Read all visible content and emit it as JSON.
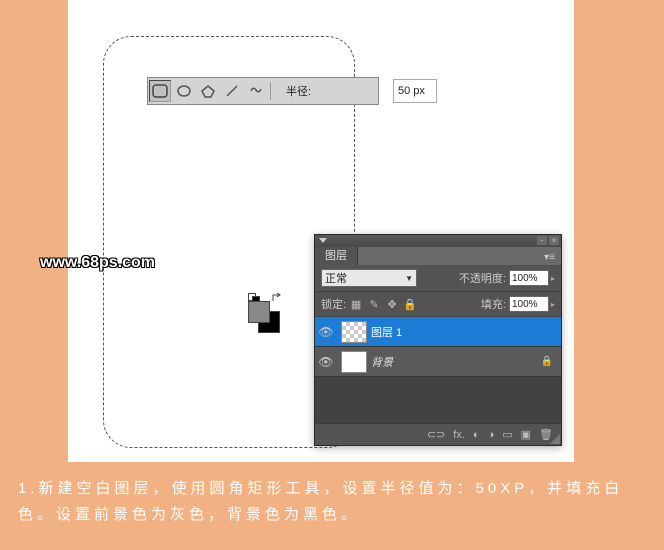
{
  "canvas": {
    "options_bar": {
      "radius_label": "半径:",
      "radius_value": "50 px"
    }
  },
  "watermark": "www.68ps.com",
  "layers_panel": {
    "tab": "图层",
    "blend_mode": "正常",
    "opacity_label": "不透明度:",
    "opacity_value": "100%",
    "lock_label": "锁定:",
    "fill_label": "填充:",
    "fill_value": "100%",
    "layers": [
      {
        "name": "图层 1",
        "active": true,
        "locked": false
      },
      {
        "name": "背景",
        "active": false,
        "locked": true
      }
    ]
  },
  "caption": "1.新建空白图层，使用圆角矩形工具，设置半径值为：50XP，并填充白色。设置前景色为灰色，背景色为黑色。"
}
